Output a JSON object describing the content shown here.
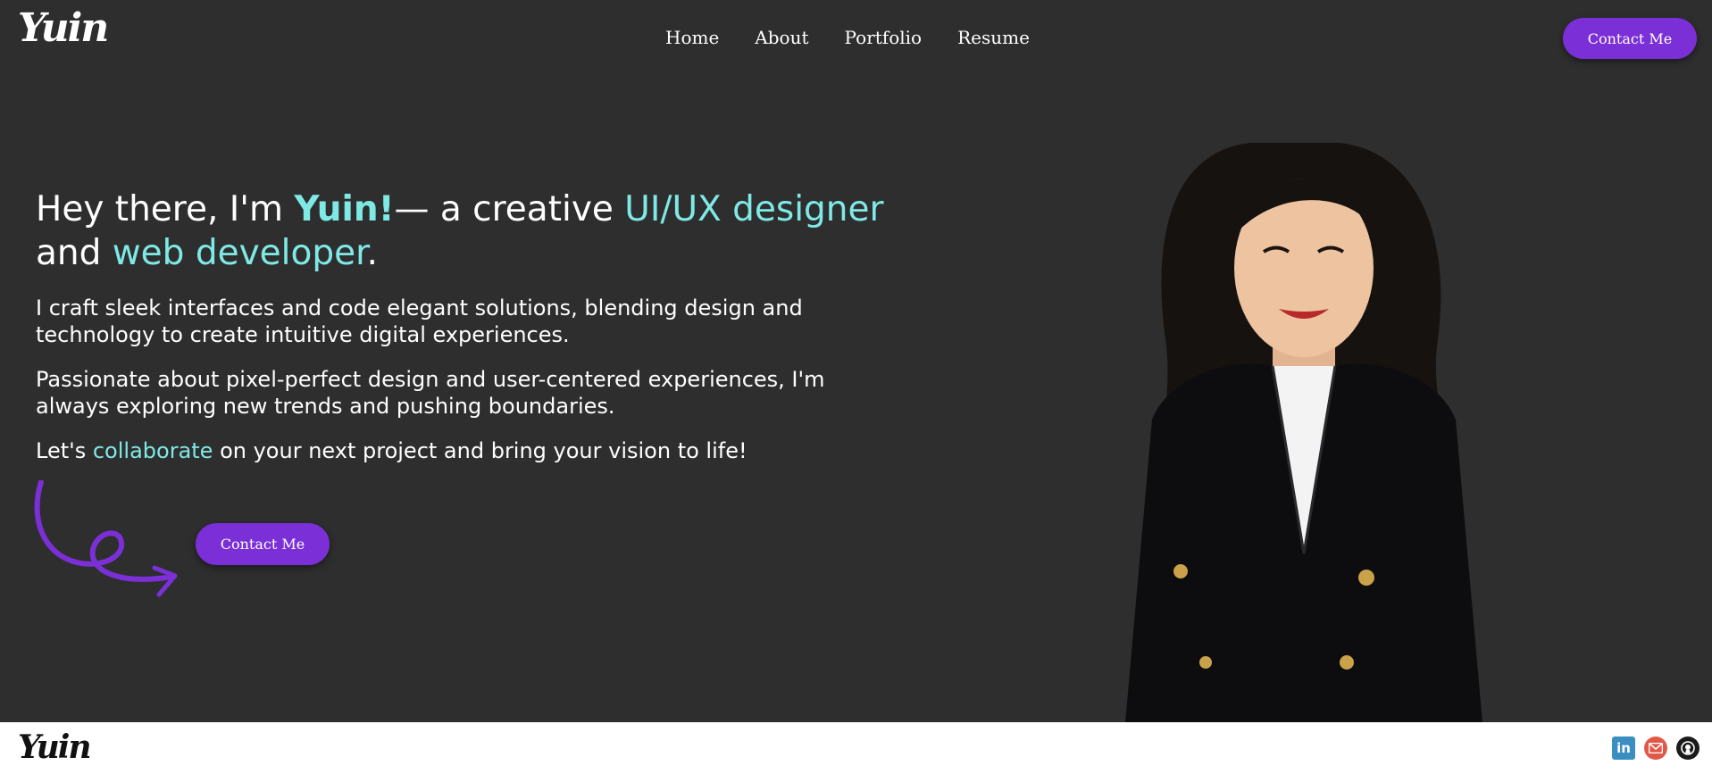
{
  "header": {
    "logo": "Yuin",
    "nav": [
      {
        "label": "Home"
      },
      {
        "label": "About"
      },
      {
        "label": "Portfolio"
      },
      {
        "label": "Resume"
      }
    ],
    "contact_label": "Contact Me"
  },
  "hero": {
    "headline": {
      "part1": "Hey there, I'm ",
      "name": "Yuin!",
      "part2": "— a creative ",
      "role1": "UI/UX designer",
      "part3": " and ",
      "role2": "web developer",
      "part4": "."
    },
    "paragraph1": "I craft sleek interfaces and code elegant solutions, blending design and technology to create intuitive digital experiences.",
    "paragraph2": "Passionate about pixel-perfect design and user-centered experiences, I'm always exploring new trends and pushing boundaries.",
    "paragraph3": {
      "part1": "Let's ",
      "highlight": "collaborate",
      "part2": " on your next project and bring your vision to life!"
    },
    "contact_label": "Contact Me"
  },
  "footer": {
    "logo": "Yuin",
    "social": [
      {
        "icon": "linkedin-icon",
        "text": "in"
      },
      {
        "icon": "email-icon"
      },
      {
        "icon": "github-icon"
      }
    ]
  },
  "colors": {
    "background": "#2e2e2e",
    "accent": "#7b2fd6",
    "highlight": "#7fe9e6",
    "footer": "#ffffff"
  }
}
